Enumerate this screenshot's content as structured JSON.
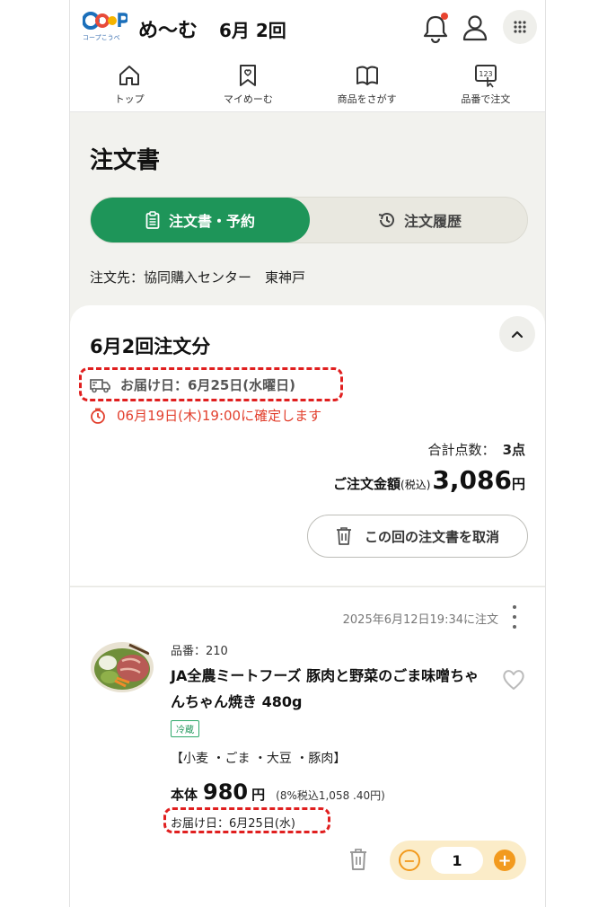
{
  "header": {
    "logo_text": "CO·OP",
    "logo_sub": "コープこうべ",
    "brand": "め〜む",
    "round": "6月 2回"
  },
  "nav": {
    "items": [
      {
        "label": "トップ",
        "icon": "home-icon"
      },
      {
        "label": "マイめーむ",
        "icon": "bookmark-heart-icon"
      },
      {
        "label": "商品をさがす",
        "icon": "book-icon"
      },
      {
        "label": "品番で注文",
        "icon": "number-pad-icon"
      }
    ]
  },
  "page": {
    "title": "注文書",
    "tabs": [
      {
        "label": "注文書・予約",
        "active": true
      },
      {
        "label": "注文履歴",
        "active": false
      }
    ],
    "destination": "注文先：協同購入センター　東神戸"
  },
  "order": {
    "title": "6月2回注文分",
    "delivery": "お届け日：6月25日(水曜日)",
    "deadline": "06月19日(木)19:00に確定します",
    "count_label": "合計点数：",
    "count_value": "3点",
    "total_label": "ご注文金額",
    "total_tax": "(税込)",
    "total_value": "3,086",
    "total_unit": "円",
    "cancel_label": "この回の注文書を取消"
  },
  "item": {
    "ordered_at": "2025年6月12日19:34に注文",
    "number": "品番：210",
    "name": "JA全農ミートフーズ 豚肉と野菜のごま味噌ちゃんちゃん焼き 480g",
    "tag": "冷蔵",
    "allergens": "【小麦 ・ごま ・大豆 ・豚肉】",
    "price_label": "本体",
    "price_value": "980",
    "price_unit": "円",
    "price_tax": "(8%税込1,058 .40円)",
    "delivery": "お届け日：6月25日(水)",
    "quantity": "1",
    "minus": "−",
    "plus": "+"
  },
  "colors": {
    "accent": "#1e9559",
    "alert": "#e2402e",
    "highlight": "#e01f1f",
    "qty_accent": "#f29a1e"
  }
}
